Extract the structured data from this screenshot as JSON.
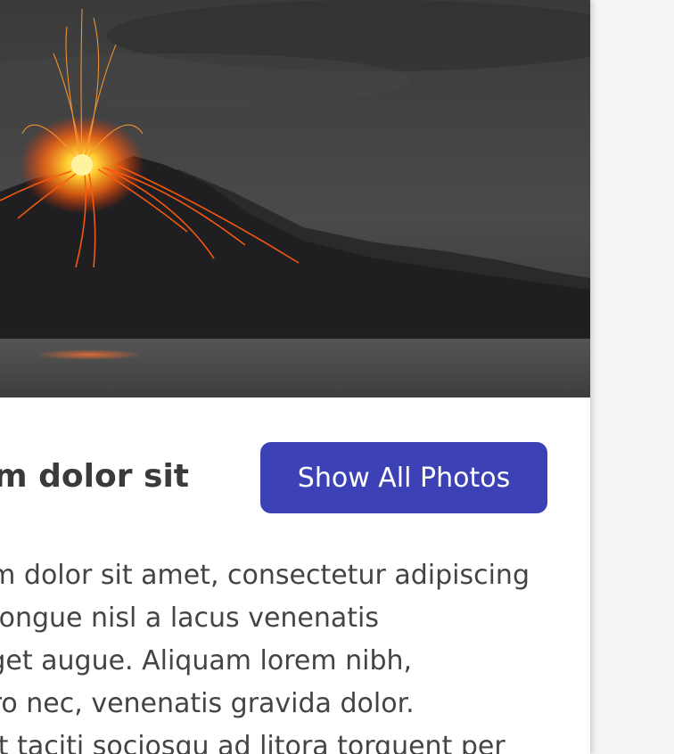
{
  "card": {
    "title": "Lorem ipsum dolor sit",
    "button_label": "Show All Photos",
    "body_lines": [
      "Lorem ipsum dolor sit amet, consectetur adipiscing",
      "elit. Morbi congue nisl a lacus venenatis",
      "interdum eget augue. Aliquam lorem nibh,",
      "aliquet libero nec, venenatis gravida dolor.",
      "Class aptent taciti sociosqu ad litora torquent per"
    ]
  },
  "colors": {
    "button_background": "#3c41b6",
    "lava": "#ff5a10",
    "sky": "#3c3c3c"
  },
  "icons": {
    "hero_image": "volcano-eruption-photo"
  }
}
